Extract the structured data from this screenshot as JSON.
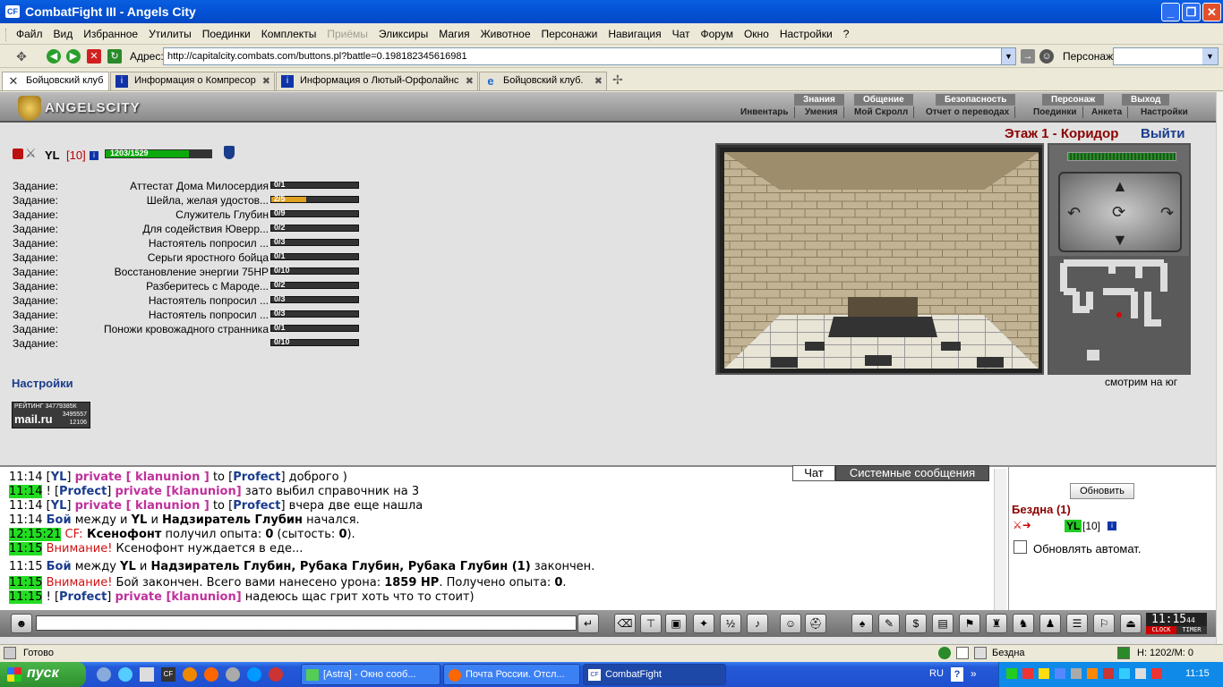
{
  "window": {
    "title": "CombatFight III - Angels City",
    "icon_text": "CF"
  },
  "menu": [
    "Файл",
    "Вид",
    "Избранное",
    "Утилиты",
    "Поединки",
    "Комплекты",
    "Приёмы",
    "Эликсиры",
    "Магия",
    "Животное",
    "Персонажи",
    "Навигация",
    "Чат",
    "Форум",
    "Окно",
    "Настройки",
    "?"
  ],
  "address": {
    "label": "Адрес:",
    "url": "http://capitalcity.combats.com/buttons.pl?battle=0.198182345616981",
    "persona_label": "Персонаж:"
  },
  "tabs": [
    {
      "label": "Бойцовский клуб",
      "icon": "close-icon"
    },
    {
      "label": "Информация о Компресор",
      "icon": "info-icon"
    },
    {
      "label": "Информация о Лютый-Орфолайнс",
      "icon": "info-icon"
    },
    {
      "label": "Бойцовский клуб.",
      "icon": "ie-icon"
    }
  ],
  "game": {
    "logo": "ANGELSCITY",
    "nav_top": [
      "Знания",
      "Общение",
      "Безопасность",
      "Персонаж",
      "Выход"
    ],
    "nav_bottom": [
      "Инвентарь",
      "Умения",
      "Мой Скролл",
      "Отчет о переводах",
      "Поединки",
      "Анкета",
      "Настройки"
    ],
    "player": {
      "name": "YL",
      "level": "[10]",
      "hp_text": "1203/1529",
      "hp_fraction": 0.787
    },
    "quest_label": "Задание:",
    "quests": [
      {
        "name": "Аттестат Дома Милосердия",
        "progress": "0/1",
        "fraction": 0
      },
      {
        "name": "Шейла, желая удостов...",
        "progress": "2/5",
        "fraction": 0.4
      },
      {
        "name": "Служитель Глубин",
        "progress": "0/9",
        "fraction": 0
      },
      {
        "name": "Для содействия Юверр...",
        "progress": "0/2",
        "fraction": 0
      },
      {
        "name": "Настоятель попросил ...",
        "progress": "0/3",
        "fraction": 0
      },
      {
        "name": "Серьги яростного бойца",
        "progress": "0/1",
        "fraction": 0
      },
      {
        "name": "Восстановление энергии 75HP",
        "progress": "0/10",
        "fraction": 0
      },
      {
        "name": "Разберитесь с Мароде...",
        "progress": "0/2",
        "fraction": 0
      },
      {
        "name": "Настоятель попросил ...",
        "progress": "0/3",
        "fraction": 0
      },
      {
        "name": "Настоятель попросил ...",
        "progress": "0/3",
        "fraction": 0
      },
      {
        "name": "Поножи кровожадного странника",
        "progress": "0/1",
        "fraction": 0
      },
      {
        "name": "",
        "progress": "0/10",
        "fraction": 0
      }
    ],
    "settings_link": "Настройки",
    "rating": {
      "line1": "РЕЙТИНГ 34779385К",
      "brand": "mail.ru",
      "n1": "3495557",
      "n2": "12106"
    },
    "location": "Этаж 1 - Коридор",
    "exit": "Выйти",
    "facing": "смотрим на юг"
  },
  "chat": {
    "tabs": [
      "Чат",
      "Системные сообщения"
    ],
    "lines": [
      {
        "t": "11:14",
        "hl": false,
        "p": [
          "[",
          "YL",
          "] ",
          "private [ klanunion ]",
          " to [",
          "Profect",
          "] доброго )"
        ]
      },
      {
        "t": "11:14",
        "hl": true,
        "p": [
          "! [",
          "Profect",
          "] ",
          "private [klanunion]",
          " зато выбил справочник на 3",
          "",
          ""
        ]
      },
      {
        "t": "11:14",
        "hl": false,
        "p": [
          "[",
          "YL",
          "] ",
          "private [ klanunion ]",
          " to [",
          "Profect",
          "] вчера две еще нашла"
        ]
      },
      {
        "t": "11:14",
        "hl": false,
        "p": [
          "Бой",
          " между и ",
          "YL",
          " и ",
          "Надзиратель Глубин",
          " начался.",
          ""
        ]
      },
      {
        "t": "12:15:21",
        "hl": true,
        "p": [
          "CF:",
          " Ксенофонт",
          " получил опыта: ",
          "0",
          " (сытость: ",
          "0",
          "). "
        ]
      },
      {
        "t": "11:15",
        "hl": true,
        "p": [
          "Внимание!",
          " Ксенофонт нуждается в еде...",
          "",
          "",
          "",
          "",
          ""
        ]
      },
      {
        "t": "11:15",
        "hl": false,
        "p": [
          "Бой",
          " между ",
          "YL",
          " и ",
          "Надзиратель Глубин, Рубака Глубин, Рубака Глубин (1)",
          " закончен.",
          ""
        ]
      },
      {
        "t": "11:15",
        "hl": true,
        "p": [
          "Внимание!",
          " Бой закончен. Всего вами нанесено урона: ",
          "1859 HP",
          ". Получено опыта: ",
          "0",
          ".",
          ""
        ]
      },
      {
        "t": "11:15",
        "hl": true,
        "p": [
          "! [",
          "Profect",
          "] ",
          "private [klanunion]",
          " надеюсь щас грит хоть что то стоит)",
          "",
          ""
        ]
      }
    ]
  },
  "online": {
    "refresh": "Обновить",
    "room": "Бездна (1)",
    "user": "YL",
    "level": "[10]",
    "auto": "Обновлять автомат."
  },
  "clock": {
    "time": "11:15",
    "sec": "44",
    "clock_label": "CLOCK",
    "timer_label": "TIMER"
  },
  "status": {
    "left": "Готово",
    "zone": "Бездна",
    "hp": "H: 1202/M: 0"
  },
  "taskbar": {
    "start": "пуск",
    "tasks": [
      "[Astra] - Окно сооб...",
      "Почта России. Отсл...",
      "CombatFight"
    ],
    "lang": "RU",
    "time": "11:15"
  }
}
